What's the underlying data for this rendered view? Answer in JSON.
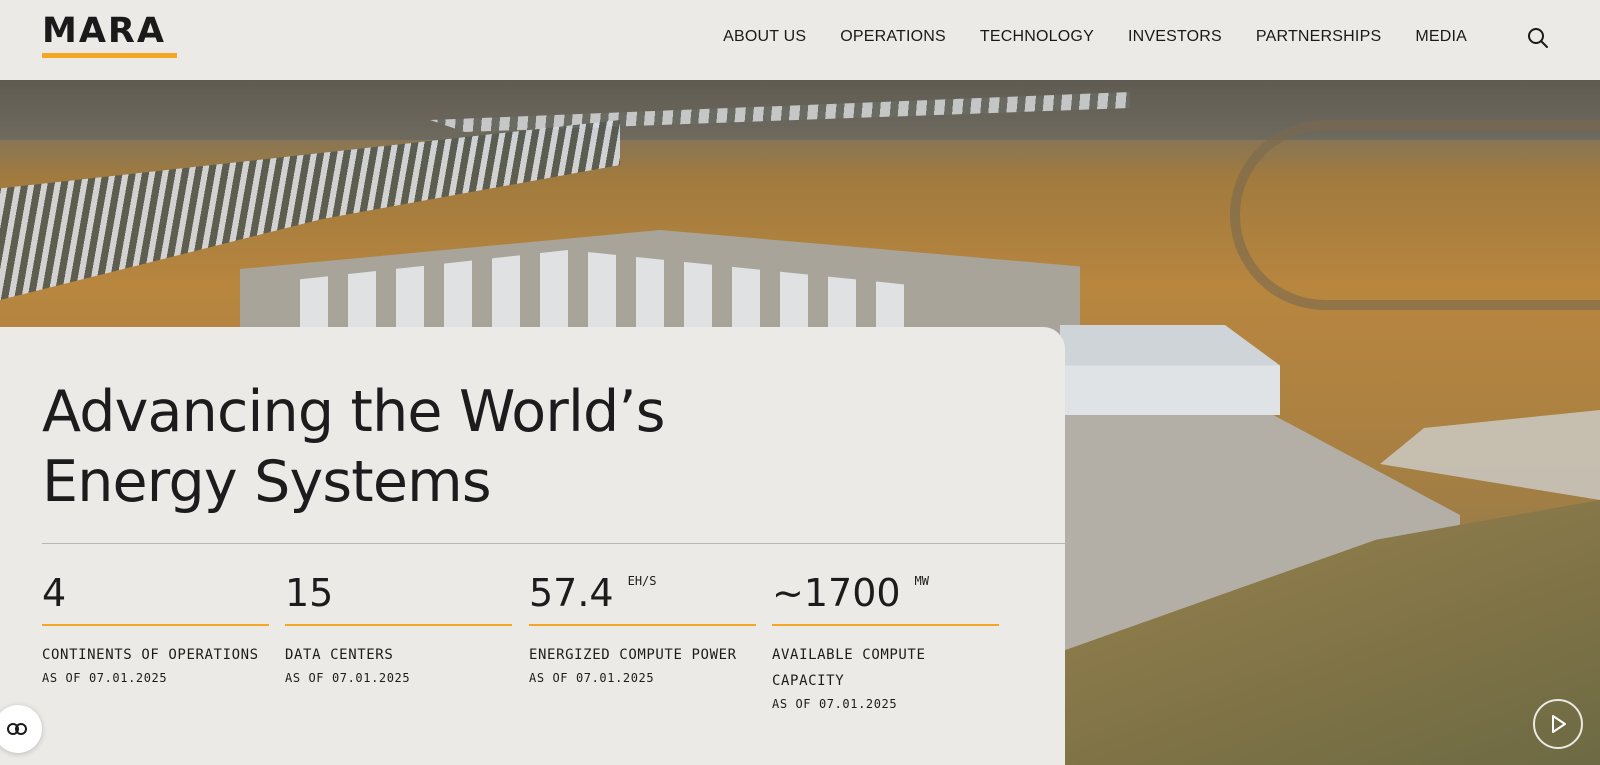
{
  "brand": {
    "logo_text": "MARA",
    "accent_color": "#f5a623"
  },
  "nav": {
    "items": [
      {
        "label": "ABOUT US"
      },
      {
        "label": "OPERATIONS"
      },
      {
        "label": "TECHNOLOGY"
      },
      {
        "label": "INVESTORS"
      },
      {
        "label": "PARTNERSHIPS"
      },
      {
        "label": "MEDIA"
      }
    ],
    "search_icon": "search-icon"
  },
  "hero": {
    "headline_line1": "Advancing the World’s",
    "headline_line2": "Energy Systems",
    "image": "aerial-data-center-fields"
  },
  "stats": [
    {
      "value": "4",
      "unit": "",
      "label": "CONTINENTS OF OPERATIONS",
      "date": "AS OF 07.01.2025"
    },
    {
      "value": "15",
      "unit": "",
      "label": "DATA CENTERS",
      "date": "AS OF 07.01.2025"
    },
    {
      "value": "57.4",
      "unit": "EH/S",
      "label": "ENERGIZED COMPUTE POWER",
      "date": "AS OF 07.01.2025"
    },
    {
      "value": "~1700",
      "unit": "MW",
      "label": "AVAILABLE COMPUTE CAPACITY",
      "date": "AS OF 07.01.2025"
    }
  ],
  "floating": {
    "cookie_icon": "cookie-settings-icon",
    "play_icon": "play-icon"
  }
}
